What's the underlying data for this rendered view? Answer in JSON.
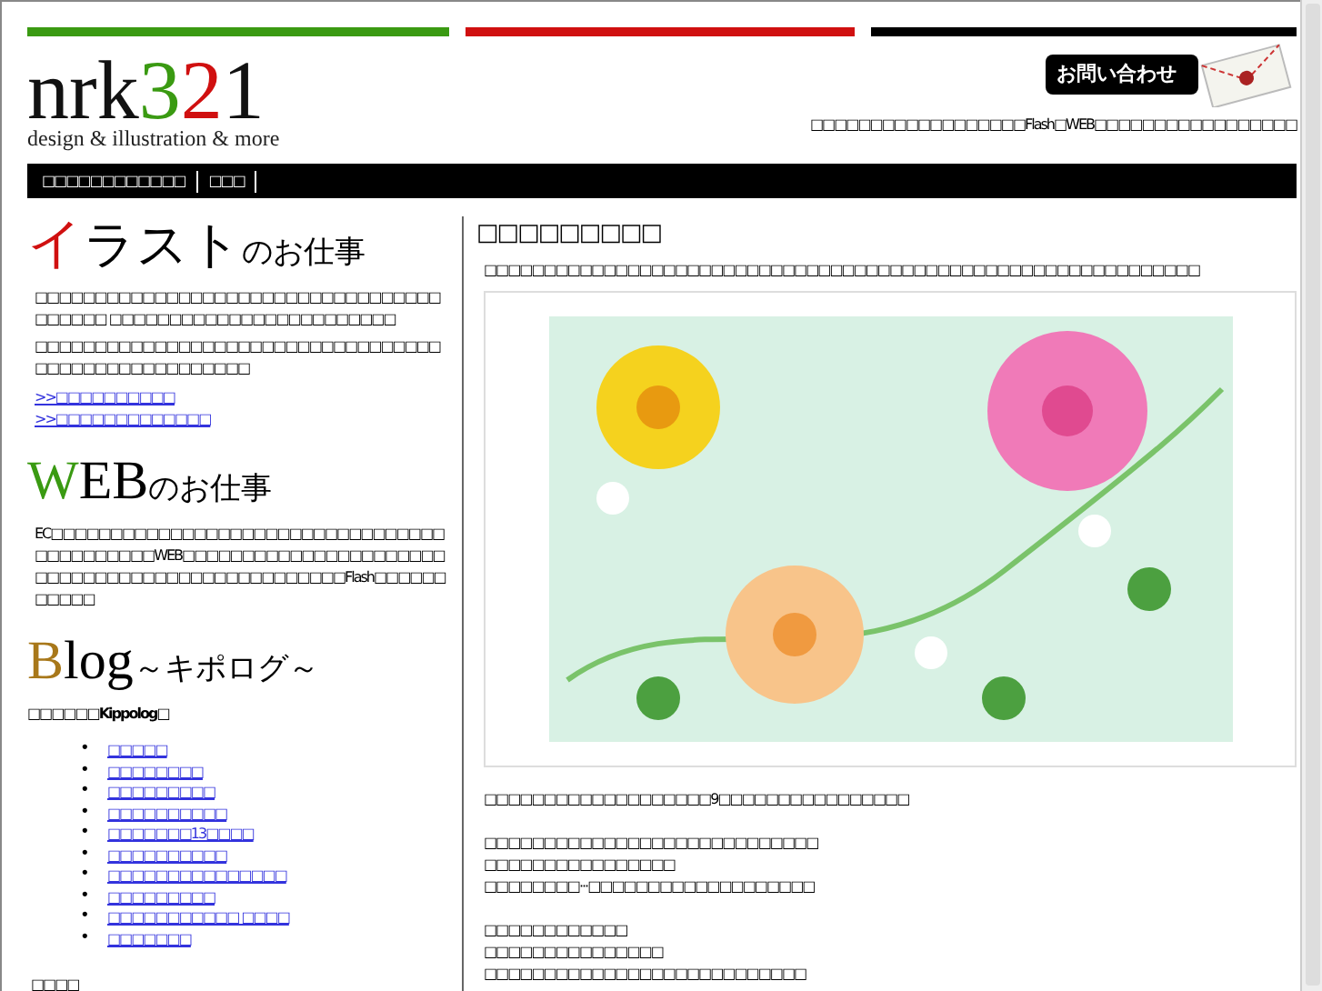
{
  "header": {
    "logo_text": "nrk321",
    "logo_tagline": "design & illustration & more",
    "contact_button": "お問い合わせ",
    "tagline": "□□□□□□□□□□□□□□□□□□Flash□WEB□□□□□□□□□□□□□□□□□"
  },
  "nav": {
    "items": [
      "□□□□□□□□□□□□",
      "□□□"
    ]
  },
  "sidebar": {
    "sections": [
      {
        "kind": "illust",
        "heading_accent": "イ",
        "heading_main": "ラスト",
        "heading_suffix": "のお仕事",
        "paragraphs": [
          "□□□□□□□□□□□□□□□□□□□□□□□□□□□□□□□□□□□□□□□□ □□□□□□□□□□□□□□□□□□□□□□□□",
          "□□□□□□□□□□□□□□□□□□□□□□□□□□□□□□□□□□□□□□□□□□□□□□□□□□□□"
        ],
        "links": [
          ">>□□□□□□□□□□",
          ">>□□□□□□□□□□□□□"
        ]
      },
      {
        "kind": "web",
        "heading_accent": "W",
        "heading_main": "EB",
        "heading_suffix": "のお仕事",
        "paragraphs": [
          "EC□□□□□□□□□□□□□□□□□□□□□□□□□□□□□□□□□□□□□□□□□□□WEB□□□□□□□□□□□□□□□□□□□□□□□□□□□□□□□□□□□□□□□□□□□□□□□□Flash□□□□□□□□□□□"
        ]
      },
      {
        "kind": "blog",
        "heading_accent": "B",
        "heading_main": "log",
        "heading_suffix": "～キポログ～",
        "bullet": "•",
        "subtitle": "□□□□□□Kippolog□",
        "list": [
          "□□□□□",
          "□□□□□□□□",
          "□□□□□□□□□",
          "□□□□□□□□□□",
          "□□□□□□□13□□□□",
          "□□□□□□□□□□",
          "□□□□□□□□□□□□□□□",
          "□□□□□□□□□",
          "□□□□□□□□□□□ □□□□",
          "□□□□□□□"
        ],
        "footer_heading": "□□□□"
      }
    ]
  },
  "main": {
    "title": "□□□□□□□□□",
    "intro": "□□□□□□□□□□□□□□□□□□□□□□□□□□□□□□□□□□□□□□□□□□□□□□□□□□□□□□□□□□□□",
    "paragraphs": [
      [
        "□□□□□□□□□□□□□□□□□□□9□□□□□□□□□□□□□□□□"
      ],
      [
        "□□□□□□□□□□□□□□□□□□□□□□□□□□□□",
        "□□□□□□□□□□□□□□□□",
        "□□□□□□□□···□□□□□□□□□□□□□□□□□□□"
      ],
      [
        "□□□□□□□□□□□□",
        "□□□□□□□□□□□□□□□",
        "□□□□□□□□□□□□□□□□□□□□□□□□□□□"
      ]
    ]
  }
}
